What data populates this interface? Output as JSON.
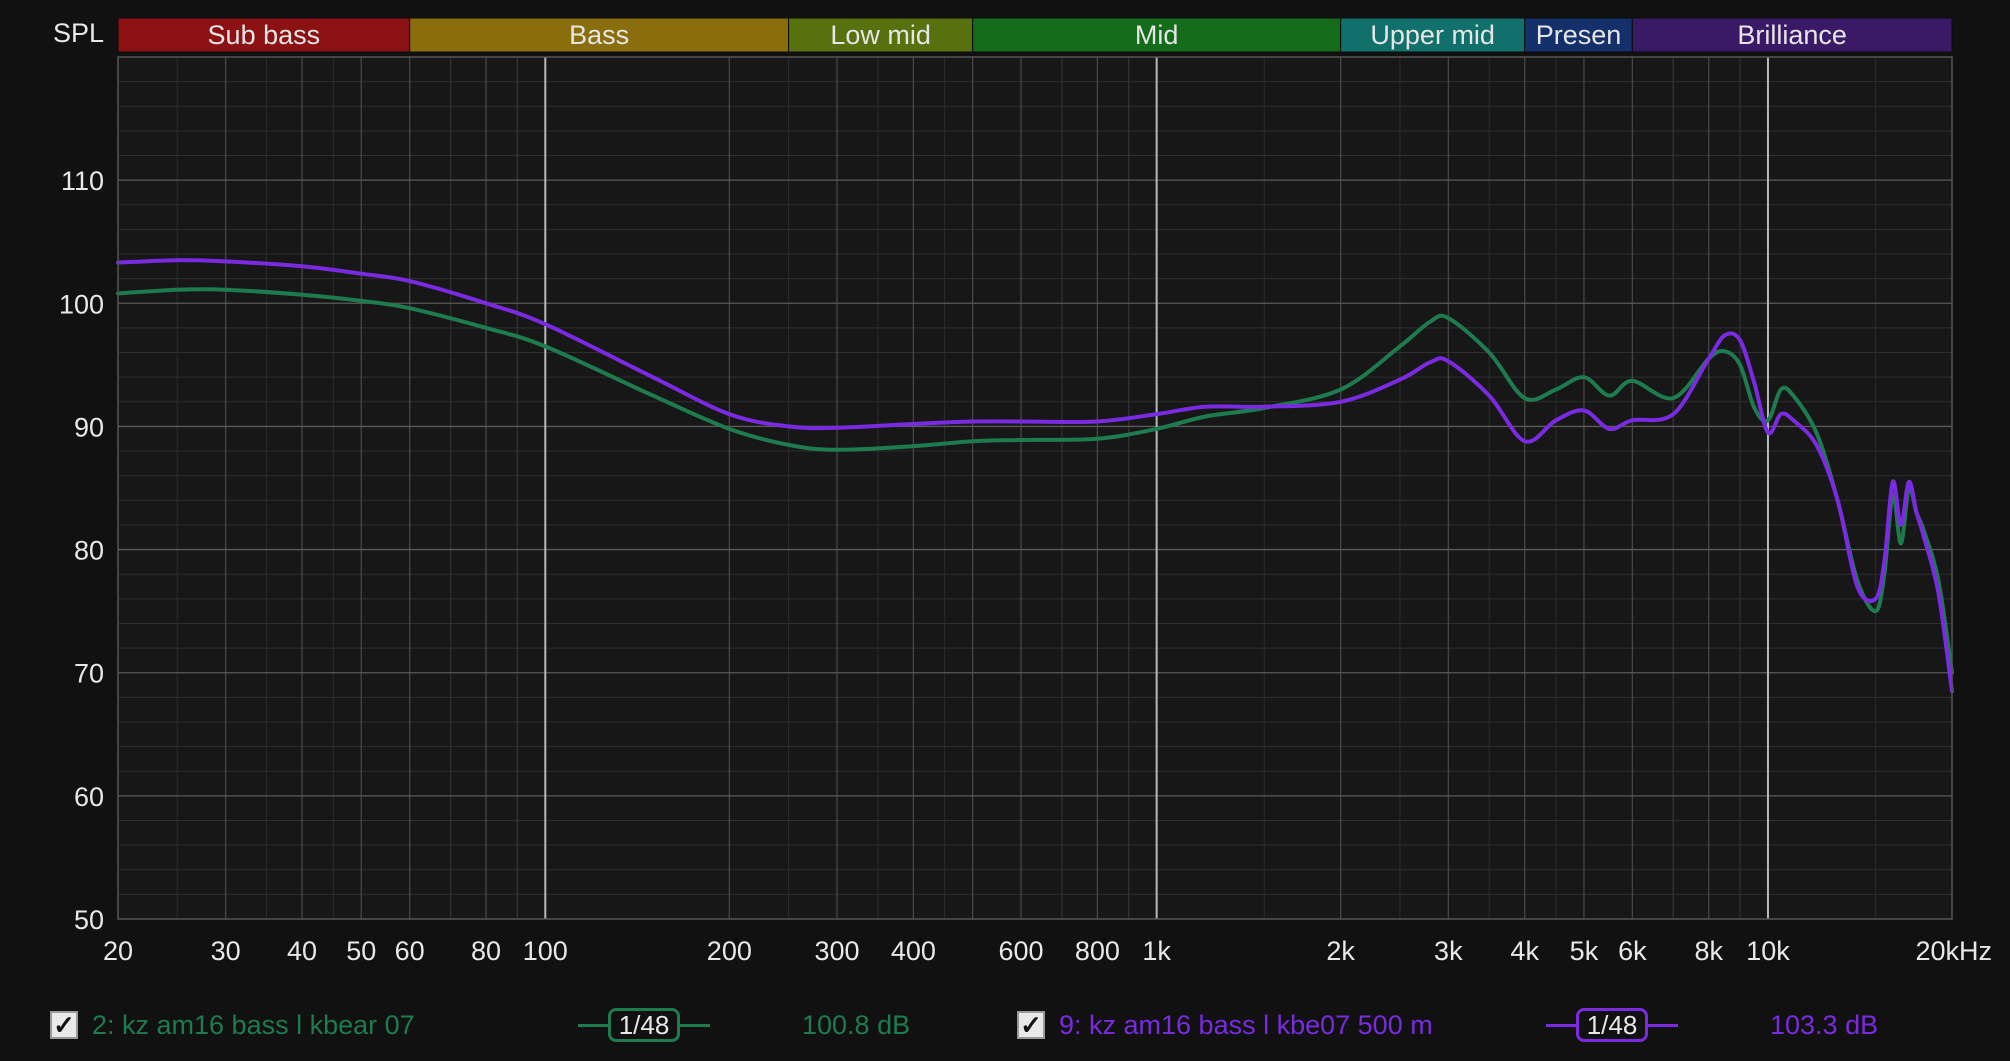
{
  "chart_data": {
    "type": "line",
    "ylabel": "SPL",
    "y_ticks": [
      50,
      60,
      70,
      80,
      90,
      100,
      110
    ],
    "ylim": [
      50,
      120
    ],
    "xlim": [
      20,
      20000
    ],
    "x_scale": "log",
    "x_tick_values": [
      20,
      30,
      40,
      50,
      60,
      80,
      100,
      200,
      300,
      400,
      600,
      800,
      1000,
      2000,
      3000,
      4000,
      5000,
      6000,
      8000,
      10000,
      20000
    ],
    "x_tick_labels": [
      "20",
      "30",
      "40",
      "50",
      "60",
      "80",
      "100",
      "200",
      "300",
      "400",
      "600",
      "800",
      "1k",
      "2k",
      "3k",
      "4k",
      "5k",
      "6k",
      "8k",
      "10k",
      "20kHz"
    ],
    "grid": true,
    "bands": [
      {
        "label": "Sub bass",
        "from": 20,
        "to": 60,
        "color": "#8b1113"
      },
      {
        "label": "Bass",
        "from": 60,
        "to": 250,
        "color": "#8a6d0c"
      },
      {
        "label": "Low mid",
        "from": 250,
        "to": 500,
        "color": "#56710e"
      },
      {
        "label": "Mid",
        "from": 500,
        "to": 2000,
        "color": "#146b1a"
      },
      {
        "label": "Upper mid",
        "from": 2000,
        "to": 4000,
        "color": "#11706b"
      },
      {
        "label": "Presen",
        "from": 4000,
        "to": 6000,
        "color": "#14306b"
      },
      {
        "label": "Brilliance",
        "from": 6000,
        "to": 20000,
        "color": "#3a1a66"
      }
    ],
    "series": [
      {
        "name": "2: kz am16 bass l kbear 07",
        "color": "#1e7b4e",
        "x": [
          20,
          25,
          30,
          40,
          50,
          60,
          80,
          100,
          150,
          200,
          250,
          300,
          400,
          500,
          600,
          800,
          1000,
          1200,
          1500,
          2000,
          2500,
          2800,
          3000,
          3500,
          4000,
          4500,
          5000,
          5500,
          6000,
          7000,
          8000,
          8500,
          9000,
          9500,
          10000,
          10500,
          11000,
          12000,
          13000,
          14000,
          15000,
          15500,
          16000,
          16500,
          17000,
          17500,
          18000,
          19000,
          20000
        ],
        "y": [
          100.8,
          101.1,
          101.1,
          100.7,
          100.2,
          99.6,
          98.0,
          96.5,
          92.5,
          89.8,
          88.5,
          88.1,
          88.4,
          88.8,
          88.9,
          89.0,
          89.8,
          90.8,
          91.5,
          93.0,
          96.5,
          98.5,
          98.8,
          96.0,
          92.3,
          93.0,
          94.0,
          92.5,
          93.7,
          92.3,
          95.5,
          96.1,
          95.0,
          91.5,
          90.5,
          93.0,
          92.5,
          89.5,
          84.0,
          77.5,
          75.0,
          78.0,
          84.5,
          80.5,
          85.0,
          83.0,
          81.5,
          77.5,
          70.0
        ]
      },
      {
        "name": "9: kz am16 bass l kbe07 500 m",
        "color": "#7a2ae0",
        "x": [
          20,
          25,
          30,
          40,
          50,
          60,
          80,
          100,
          150,
          200,
          250,
          300,
          400,
          500,
          600,
          800,
          1000,
          1200,
          1500,
          2000,
          2500,
          2800,
          3000,
          3500,
          4000,
          4500,
          5000,
          5500,
          6000,
          7000,
          8000,
          8500,
          9000,
          9500,
          10000,
          10500,
          11000,
          12000,
          13000,
          14000,
          15000,
          15500,
          16000,
          16500,
          17000,
          17500,
          18000,
          19000,
          20000
        ],
        "y": [
          103.3,
          103.5,
          103.4,
          103.0,
          102.4,
          101.8,
          100.0,
          98.3,
          94.0,
          91.0,
          90.0,
          89.9,
          90.2,
          90.4,
          90.4,
          90.4,
          91.0,
          91.6,
          91.6,
          92.0,
          93.8,
          95.2,
          95.3,
          92.5,
          88.8,
          90.5,
          91.3,
          89.8,
          90.5,
          91.0,
          95.5,
          97.4,
          97.0,
          93.5,
          89.5,
          91.0,
          90.5,
          88.5,
          84.0,
          77.0,
          76.0,
          79.0,
          85.5,
          82.0,
          85.5,
          83.0,
          81.0,
          76.5,
          68.5
        ]
      }
    ]
  },
  "legend": [
    {
      "checked_glyph": "✓",
      "label": "2: kz am16 bass l kbear 07",
      "smoothing": "1/48",
      "level": "100.8 dB",
      "color": "#1e7b4e"
    },
    {
      "checked_glyph": "✓",
      "label": "9: kz am16 bass l kbe07 500 m",
      "smoothing": "1/48",
      "level": "103.3 dB",
      "color": "#7a2ae0"
    }
  ]
}
